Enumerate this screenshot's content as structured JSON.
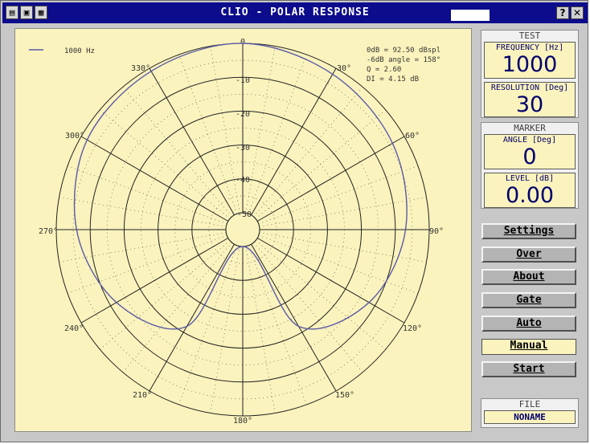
{
  "window": {
    "title": "CLIO - POLAR RESPONSE",
    "help_label": "?",
    "close_label": "✕"
  },
  "plot": {
    "legend": {
      "label": "1000 Hz",
      "color": "#5a5aa8"
    },
    "info": {
      "line1": "0dB = 92.50 dBspl",
      "line2": "-6dB angle = 158°",
      "line3": "Q = 2.60",
      "line4": "DI = 4.15 dB"
    },
    "angle_labels": {
      "a0": "0",
      "a30": "30°",
      "a60": "60°",
      "a90": "90°",
      "a120": "120°",
      "a150": "150°",
      "a180": "180°",
      "a210": "210°",
      "a240": "240°",
      "a270": "270°",
      "a300": "300°",
      "a330": "330°"
    },
    "ring_labels": {
      "r10": "-10",
      "r20": "-20",
      "r30": "-30",
      "r40": "-40",
      "r50": "-50"
    }
  },
  "chart_data": {
    "type": "polar",
    "series": [
      {
        "name": "1000 Hz",
        "color": "#5a5aa8",
        "angles": [
          0,
          30,
          60,
          90,
          120,
          150,
          180,
          210,
          240,
          270,
          300,
          330
        ],
        "values_db": [
          0,
          -2,
          -4,
          -7,
          -12,
          -22,
          -50,
          -22,
          -12,
          -6,
          -2,
          -1
        ]
      }
    ],
    "radial_ticks_db": [
      0,
      -10,
      -20,
      -30,
      -40,
      -50
    ],
    "angle_step_deg": 30,
    "rlim_db": [
      -50,
      0
    ]
  },
  "test_panel": {
    "title": "TEST",
    "frequency_label": "FREQUENCY [Hz]",
    "frequency_value": "1000",
    "resolution_label": "RESOLUTION [Deg]",
    "resolution_value": "30"
  },
  "marker_panel": {
    "title": "MARKER",
    "angle_label": "ANGLE [Deg]",
    "angle_value": "0",
    "level_label": "LEVEL [dB]",
    "level_value": "0.00"
  },
  "buttons": {
    "settings": "Settings",
    "over": "Over",
    "about": "About",
    "gate": "Gate",
    "auto": "Auto",
    "manual": "Manual",
    "start": "Start"
  },
  "file_panel": {
    "title": "FILE",
    "name": "NONAME"
  }
}
